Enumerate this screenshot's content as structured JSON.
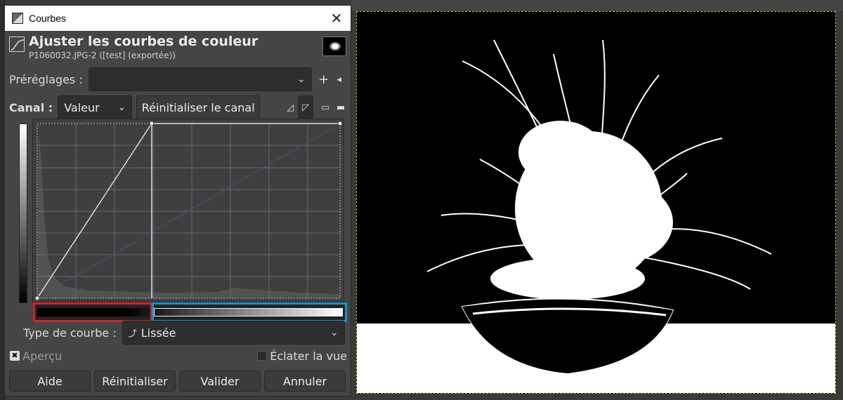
{
  "window": {
    "title": "Courbes",
    "close_symbol": "✕"
  },
  "header": {
    "title": "Ajuster les courbes de couleur",
    "subtitle": "P1060032.JPG-2 ([test] (exportée))"
  },
  "presets": {
    "label": "Préréglages :",
    "value": "",
    "add_symbol": "+",
    "menu_symbol": "◂"
  },
  "channel": {
    "label": "Canal :",
    "value": "Valeur",
    "reset_label": "Réinitialiser le canal"
  },
  "curve": {
    "points": [
      [
        0,
        0
      ],
      [
        0.378,
        1
      ],
      [
        1,
        1
      ]
    ],
    "histogram_peak_x": 0.03
  },
  "curve_type": {
    "label": "Type de courbe :",
    "value": "Lissée",
    "icon_symbol": "⤴"
  },
  "options": {
    "preview_label": "Aperçu",
    "preview_checked": true,
    "split_view_label": "Éclater la vue",
    "split_view_checked": false
  },
  "buttons": {
    "help": "Aide",
    "reset": "Réinitialiser",
    "ok": "Valider",
    "cancel": "Annuler"
  },
  "colors": {
    "dialog_bg": "#454545",
    "highlight_red": "#d4202b",
    "highlight_blue": "#1a8fd0",
    "selection_marquee": "#c9b13a"
  }
}
